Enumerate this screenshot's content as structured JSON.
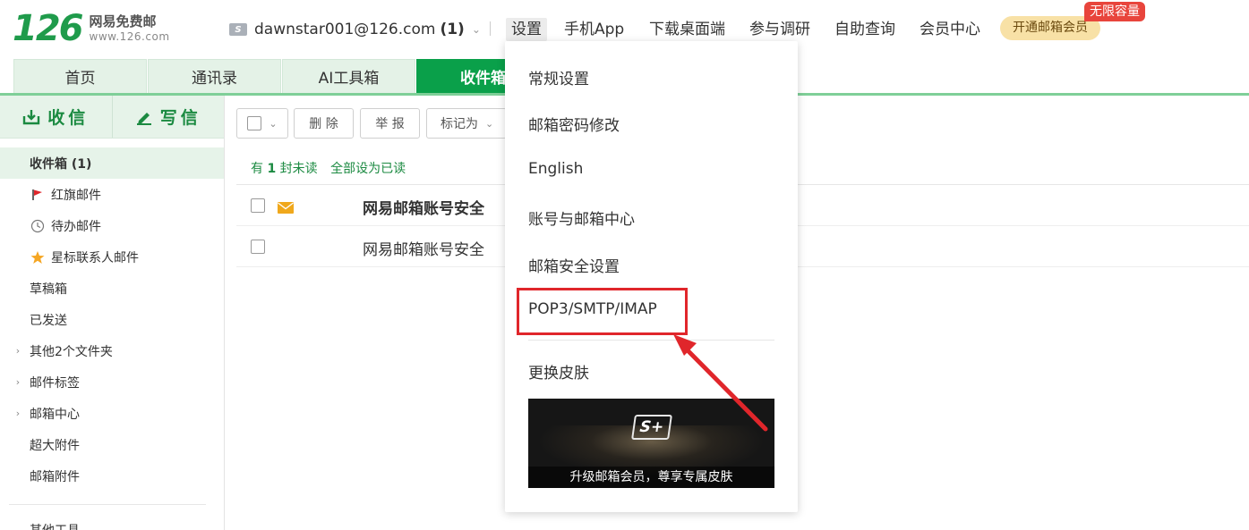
{
  "header": {
    "logo_number": "126",
    "logo_name": "网易免费邮",
    "logo_url": "www.126.com",
    "account_email": "dawnstar001@126.com",
    "account_unread": "(1)",
    "account_badge": "S",
    "nav": [
      "设置",
      "手机App",
      "下载桌面端",
      "参与调研",
      "自助查询",
      "会员中心"
    ],
    "vip_button": "开通邮箱会员",
    "vip_tag": "无限容量"
  },
  "tabs": [
    "首页",
    "通讯录",
    "AI工具箱",
    "收件箱"
  ],
  "sidebar": {
    "receive": "收信",
    "compose": "写信",
    "folders": [
      {
        "label": "收件箱 (1)",
        "icon": "none"
      },
      {
        "label": "红旗邮件",
        "icon": "red-flag-icon"
      },
      {
        "label": "待办邮件",
        "icon": "clock-icon"
      },
      {
        "label": "星标联系人邮件",
        "icon": "star-icon"
      },
      {
        "label": "草稿箱",
        "icon": "none"
      },
      {
        "label": "已发送",
        "icon": "none"
      },
      {
        "label": "其他2个文件夹",
        "icon": "chevron-right-icon"
      },
      {
        "label": "邮件标签",
        "icon": "chevron-right-icon"
      },
      {
        "label": "邮箱中心",
        "icon": "chevron-right-icon"
      },
      {
        "label": "超大附件",
        "icon": "none"
      },
      {
        "label": "邮箱附件",
        "icon": "none"
      }
    ],
    "bottom_partial": "其他工具"
  },
  "toolbar": {
    "delete": "删 除",
    "report": "举 报",
    "mark_as": "标记为"
  },
  "unread_bar": {
    "prefix": "有",
    "count": "1",
    "suffix": "封未读",
    "mark_all_read": "全部设为已读"
  },
  "mails": [
    {
      "subject": "网易邮箱账号安全",
      "unread": true
    },
    {
      "subject": "网易邮箱账号安全",
      "unread": false
    }
  ],
  "settings_menu": {
    "items": [
      "常规设置",
      "邮箱密码修改",
      "English",
      "账号与邮箱中心",
      "邮箱安全设置",
      "POP3/SMTP/IMAP",
      "更换皮肤"
    ],
    "skin_logo": "S+",
    "skin_caption": "升级邮箱会员，尊享专属皮肤"
  },
  "colors": {
    "brand_green": "#0aa04a",
    "highlight_red": "#e0262b",
    "vip_gold": "#f8e1a6"
  }
}
